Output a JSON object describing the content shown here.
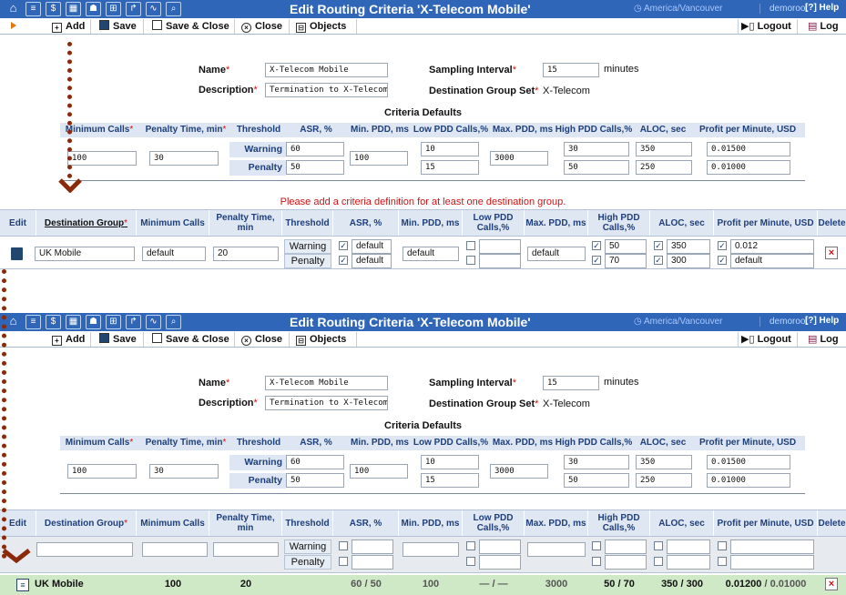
{
  "window": {
    "title": "Edit Routing Criteria 'X-Telecom Mobile'",
    "timezone": "America/Vancouver",
    "user": "demoroot",
    "help": "Help"
  },
  "toolbar": {
    "add": "Add",
    "save": "Save",
    "save_close": "Save & Close",
    "close": "Close",
    "objects": "Objects",
    "logout": "Logout",
    "log": "Log"
  },
  "form": {
    "name_label": "Name",
    "name_value": "X-Telecom Mobile",
    "description_label": "Description",
    "description_value": "Termination to X-Telecom",
    "sampling_label": "Sampling Interval",
    "sampling_value": "15",
    "sampling_unit": "minutes",
    "dgs_label": "Destination Group Set",
    "dgs_value": "X-Telecom",
    "req_mark": "*"
  },
  "criteria_defaults": {
    "title": "Criteria Defaults",
    "headers": [
      "Minimum Calls",
      "Penalty Time, min",
      "Threshold",
      "ASR, %",
      "Min. PDD, ms",
      "Low PDD Calls,%",
      "Max. PDD, ms",
      "High PDD Calls,%",
      "ALOC, sec",
      "Profit per Minute, USD"
    ],
    "warning_label": "Warning",
    "penalty_label": "Penalty",
    "min_calls": "100",
    "penalty_time": "30",
    "asr_warning": "60",
    "asr_penalty": "50",
    "min_pdd": "100",
    "low_pdd_warning": "10",
    "low_pdd_penalty": "15",
    "max_pdd": "3000",
    "high_pdd_warning": "30",
    "high_pdd_penalty": "50",
    "aloc_warning": "350",
    "aloc_penalty": "250",
    "profit_warning": "0.01500",
    "profit_penalty": "0.01000"
  },
  "grid": {
    "error": "Please add a criteria definition for at least one destination group.",
    "headers": [
      "Edit",
      "Destination Group",
      "Minimum Calls",
      "Penalty Time, min",
      "Threshold",
      "ASR, %",
      "Min. PDD, ms",
      "Low PDD Calls,%",
      "Max. PDD, ms",
      "High PDD Calls,%",
      "ALOC, sec",
      "Profit per Minute, USD",
      "Delete"
    ],
    "edit_row": {
      "destination_group": "UK Mobile",
      "min_calls": "default",
      "penalty_time": "20",
      "warning": "Warning",
      "penalty": "Penalty",
      "asr_warning": "default",
      "asr_penalty": "default",
      "min_pdd": "default",
      "max_pdd": "default",
      "high_pdd_warning": "50",
      "high_pdd_penalty": "70",
      "aloc_warning": "350",
      "aloc_penalty": "300",
      "profit_warning": "0.012",
      "profit_penalty": "default"
    },
    "saved_row": {
      "destination_group": "UK Mobile",
      "min_calls": "100",
      "penalty_time": "20",
      "asr": "60 / 50",
      "min_pdd": "100",
      "low_pdd": "— / —",
      "max_pdd": "3000",
      "high_pdd": "50 / 70",
      "aloc": "350 / 300",
      "profit_a": "0.01200",
      "profit_b": " / 0.01000"
    }
  }
}
